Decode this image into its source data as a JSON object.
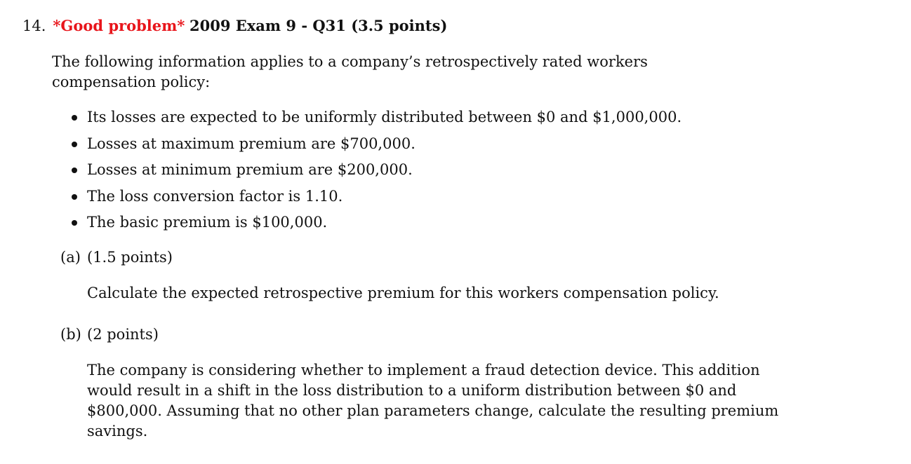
{
  "header": {
    "number": "14.",
    "highlight": "*Good problem*",
    "title": "2009 Exam 9 - Q31 (3.5 points)"
  },
  "intro": "The following information applies to a company’s retrospectively rated workers compensation policy:",
  "bullets": [
    "Its losses are expected to be uniformly distributed between $0 and $1,000,000.",
    "Losses at maximum premium are $700,000.",
    "Losses at minimum premium are $200,000.",
    "The loss conversion factor is 1.10.",
    "The basic premium is $100,000."
  ],
  "parts": [
    {
      "letter": "(a)",
      "points": "(1.5 points)",
      "text": "Calculate the expected retrospective premium for this workers compensation policy."
    },
    {
      "letter": "(b)",
      "points": "(2 points)",
      "text": "The company is considering whether to implement a fraud detection device. This addition would result in a shift in the loss distribution to a uniform distribution between $0 and $800,000. Assuming that no other plan parameters change, calculate the resulting premium savings."
    }
  ],
  "colors": {
    "highlight": "#e8151b",
    "text": "#111111"
  }
}
